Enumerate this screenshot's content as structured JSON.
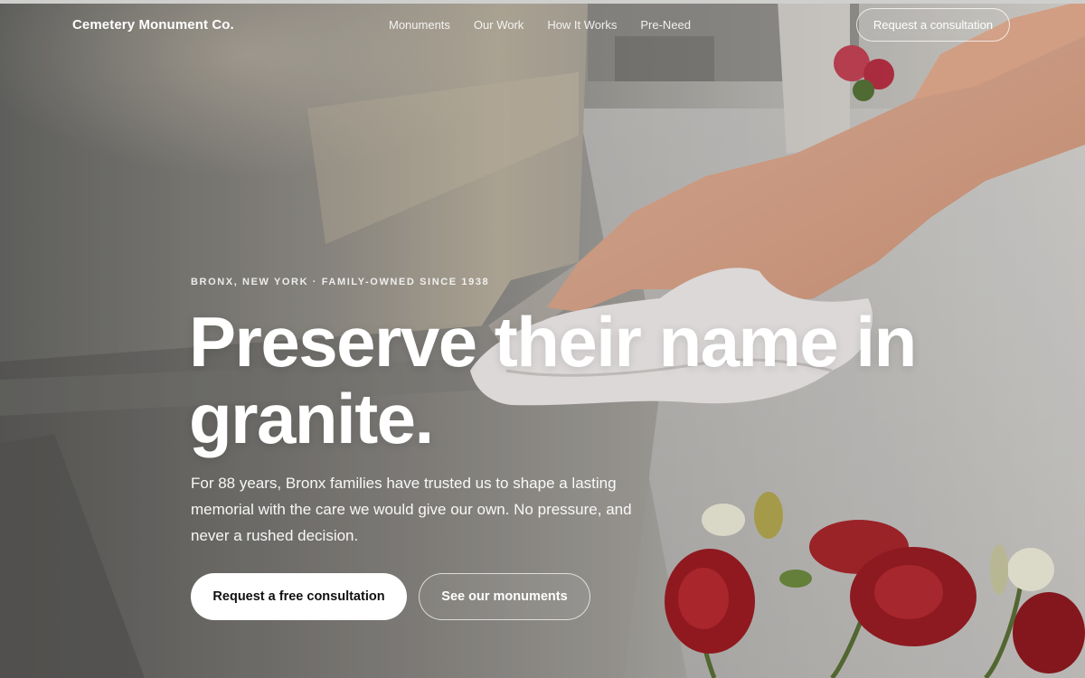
{
  "header": {
    "brand": "Cemetery Monument Co.",
    "nav": [
      "Monuments",
      "Our Work",
      "How It Works",
      "Pre-Need"
    ],
    "cta_label": "Request a consultation"
  },
  "hero": {
    "eyebrow": "BRONX, NEW YORK · FAMILY-OWNED SINCE 1938",
    "headline_line1": "Preserve their name in",
    "headline_line2": "granite.",
    "subcopy": "For 88 years, Bronx families have trusted us to shape a lasting memorial with the care we would give our own. No pressure, and never a rushed decision.",
    "primary_button": "Request a free consultation",
    "secondary_button": "See our monuments",
    "background_image": "photo of a hand wiping a granite headstone with a white cloth, red roses in foreground"
  },
  "colors": {
    "text": "#ffffff",
    "primary_button_bg": "#ffffff",
    "primary_button_text": "#111111",
    "stone": "#a9a7a2",
    "rose": "#9c1c22"
  }
}
